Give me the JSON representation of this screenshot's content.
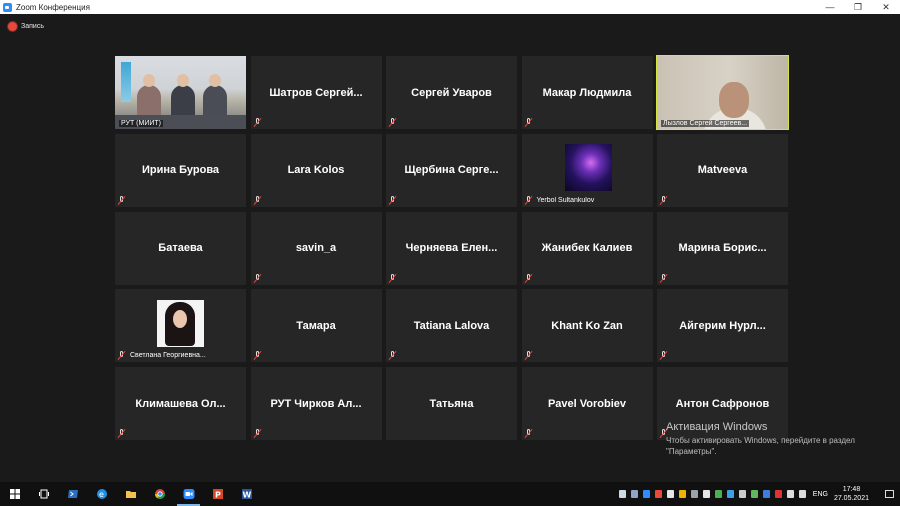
{
  "window": {
    "title": "Zoom Конференция",
    "controls": {
      "minimize": "—",
      "maximize": "❐",
      "close": "✕"
    }
  },
  "recording": {
    "label": "Запись"
  },
  "gallery": {
    "tiles": [
      {
        "label": "РУТ (МИИТ)"
      },
      {
        "name": "Шатров Сергей..."
      },
      {
        "name": "Сергей Уваров"
      },
      {
        "name": "Макар Людмила"
      },
      {
        "label": "Лызлов Сергей Сергеев..."
      },
      {
        "name": "Ирина Бурова"
      },
      {
        "name": "Lara Kolos"
      },
      {
        "name": "Щербина Серге..."
      },
      {
        "label": "Yerbol Sultankulov"
      },
      {
        "name": "Matveeva"
      },
      {
        "name": "Батаева"
      },
      {
        "name": "savin_a"
      },
      {
        "name": "Черняева Елен..."
      },
      {
        "name": "Жанибек Калиев"
      },
      {
        "name": "Марина Борис..."
      },
      {
        "label": "Светлана Георгиевна..."
      },
      {
        "name": "Тамара"
      },
      {
        "name": "Tatiana Lalova"
      },
      {
        "name": "Khant Ko Zan"
      },
      {
        "name": "Айгерим Нурл..."
      },
      {
        "name": "Климашева Ол..."
      },
      {
        "name": "РУТ Чирков Ал..."
      },
      {
        "name": "Татьяна"
      },
      {
        "name": "Pavel Vorobiev"
      },
      {
        "name": "Антон Сафронов"
      }
    ]
  },
  "watermark": {
    "title": "Активация Windows",
    "line1": "Чтобы активировать Windows, перейдите в раздел",
    "line2": "\"Параметры\"."
  },
  "taskbar": {
    "language": "ENG",
    "time": "17:48",
    "date": "27.05.2021"
  },
  "colors": {
    "background": "#1a1a1a",
    "tile": "#262626",
    "active_speaker_border": "#d7e33f",
    "mute_red": "#e8483c",
    "zoom_blue": "#2d8cff"
  }
}
